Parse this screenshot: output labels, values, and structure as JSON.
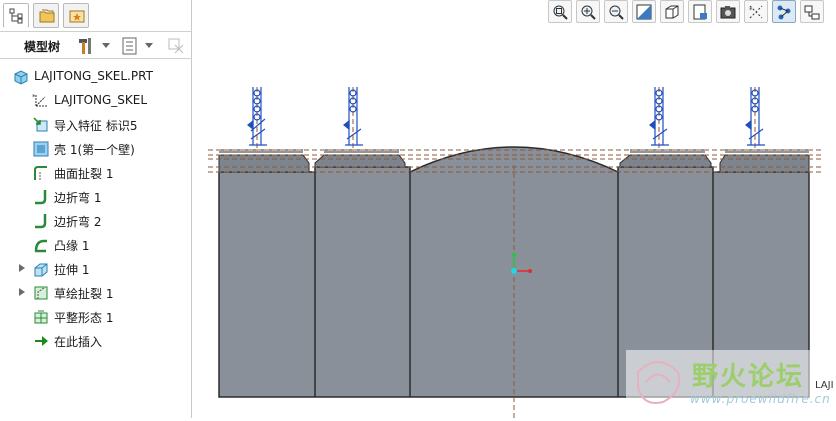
{
  "panel": {
    "tree_title": "模型树"
  },
  "tree": {
    "root": "LAJITONG_SKEL.PRT",
    "items": [
      {
        "label": "LAJITONG_SKEL",
        "icon": "coordinate-system-icon",
        "expandable": false
      },
      {
        "label": "导入特征 标识5",
        "icon": "import-feature-icon",
        "expandable": false
      },
      {
        "label": "壳 1(第一个壁)",
        "icon": "shell-wall-icon",
        "expandable": false
      },
      {
        "label": "曲面扯裂 1",
        "icon": "surface-rip-icon",
        "expandable": false
      },
      {
        "label": "边折弯 1",
        "icon": "edge-bend-icon",
        "expandable": false
      },
      {
        "label": "边折弯 2",
        "icon": "edge-bend-icon",
        "expandable": false
      },
      {
        "label": "凸缘 1",
        "icon": "flange-icon",
        "expandable": false
      },
      {
        "label": "拉伸 1",
        "icon": "extrude-icon",
        "expandable": true
      },
      {
        "label": "草绘扯裂 1",
        "icon": "sketched-rip-icon",
        "expandable": true
      },
      {
        "label": "平整形态 1",
        "icon": "flat-state-icon",
        "expandable": false
      },
      {
        "label": "在此插入",
        "icon": "insert-here-arrow-icon",
        "expandable": false
      }
    ]
  },
  "toolbar": {
    "buttons": [
      "zoom-fit-icon",
      "zoom-in-icon",
      "zoom-out-icon",
      "repaint-icon",
      "display-style-icon",
      "saved-views-icon",
      "screenshot-icon",
      "datum-display-icon",
      "spin-center-icon",
      "annotation-display-icon"
    ]
  },
  "watermark": {
    "title": "野火论坛",
    "url": "www.proewildfire.cn"
  },
  "model_tag": "LAJI",
  "colors": {
    "part_fill": "#8a9099",
    "part_edge": "#2b2b2b",
    "datum_line": "#8b5a3c",
    "selected": "#1f6cc6"
  }
}
